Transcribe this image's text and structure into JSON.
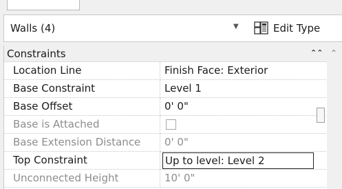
{
  "type_selector": {
    "value": "Walls (4)",
    "edit_type_label": "Edit Type"
  },
  "group": {
    "title": "Constraints"
  },
  "properties": [
    {
      "name": "Location Line",
      "value": "Finish Face: Exterior",
      "enabled": true
    },
    {
      "name": "Base Constraint",
      "value": "Level 1",
      "enabled": true
    },
    {
      "name": "Base Offset",
      "value": "0'  0\"",
      "enabled": true
    },
    {
      "name": "Base is Attached",
      "value": "",
      "checked": false,
      "enabled": false
    },
    {
      "name": "Base Extension Distance",
      "value": "0'  0\"",
      "enabled": false
    },
    {
      "name": "Top Constraint",
      "value": "Up to level: Level 2",
      "enabled": true,
      "editing": true
    },
    {
      "name": "Unconnected Height",
      "value": "10'  0\"",
      "enabled": false
    }
  ],
  "colors": {
    "panel_bg": "#f0f0f0",
    "grid_bg": "#ffffff",
    "disabled_text": "#8d8d8d"
  },
  "icons": {
    "dropdown": "chevron-down-icon",
    "edit_type": "edit-type-icon",
    "collapse": "double-chevron-up-icon",
    "scroll_up": "scroll-up-arrow-icon"
  }
}
